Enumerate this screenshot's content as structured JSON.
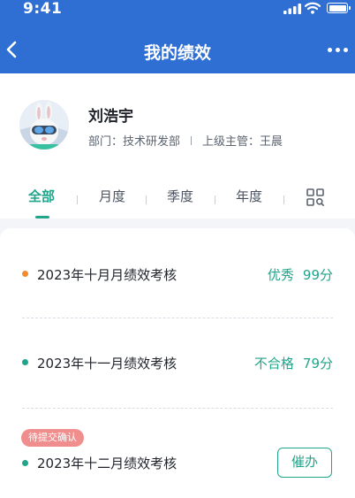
{
  "status_bar": {
    "time": "9:41",
    "icons": [
      "signal-icon",
      "wifi-icon",
      "battery-icon"
    ]
  },
  "nav": {
    "title": "我的绩效",
    "back_icon": "chevron-left-icon",
    "more_icon": "more-dots-icon"
  },
  "profile": {
    "avatar": "avatar-bunny",
    "name": "刘浩宇",
    "department": "部门：技术研发部",
    "supervisor": "上级主管：王晨"
  },
  "tabs": [
    {
      "label": "全部",
      "active": true
    },
    {
      "label": "月度",
      "active": false
    },
    {
      "label": "季度",
      "active": false
    },
    {
      "label": "年度",
      "active": false
    }
  ],
  "tabs_extra_icon": "qr-scan-icon",
  "records": [
    {
      "title": "2023年十月月绩效考核",
      "dot_color": "#f28a2e",
      "grade": "优秀",
      "score": "99分"
    },
    {
      "title": "2023年十一月绩效考核",
      "dot_color": "#21a58a",
      "grade": "不合格",
      "score": "79分"
    },
    {
      "title": "2023年十二月绩效考核",
      "dot_color": "#21a58a",
      "tag": "待提交确认",
      "action_label": "催办"
    }
  ],
  "colors": {
    "brand_blue": "#2f6fd4",
    "accent_green": "#21a58a",
    "tag_red": "#f08e8e",
    "orange": "#f28a2e"
  }
}
